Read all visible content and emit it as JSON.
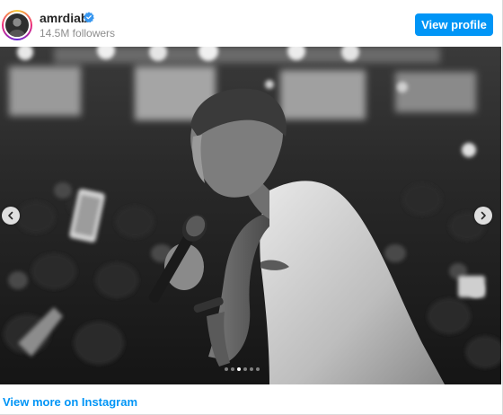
{
  "profile": {
    "username": "amrdiab",
    "followers": "14.5M followers",
    "verified": true
  },
  "header": {
    "view_profile_label": "View profile"
  },
  "media": {
    "carousel_count": 6,
    "active_index": 2,
    "icons": {
      "prev": "chevron-left-icon",
      "next": "chevron-right-icon",
      "verified": "verified-badge-icon"
    }
  },
  "footer": {
    "view_more_label": "View more on Instagram"
  },
  "colors": {
    "accent": "#0095f6",
    "verified": "#3897f0",
    "secondary_text": "#8e8e8e"
  }
}
